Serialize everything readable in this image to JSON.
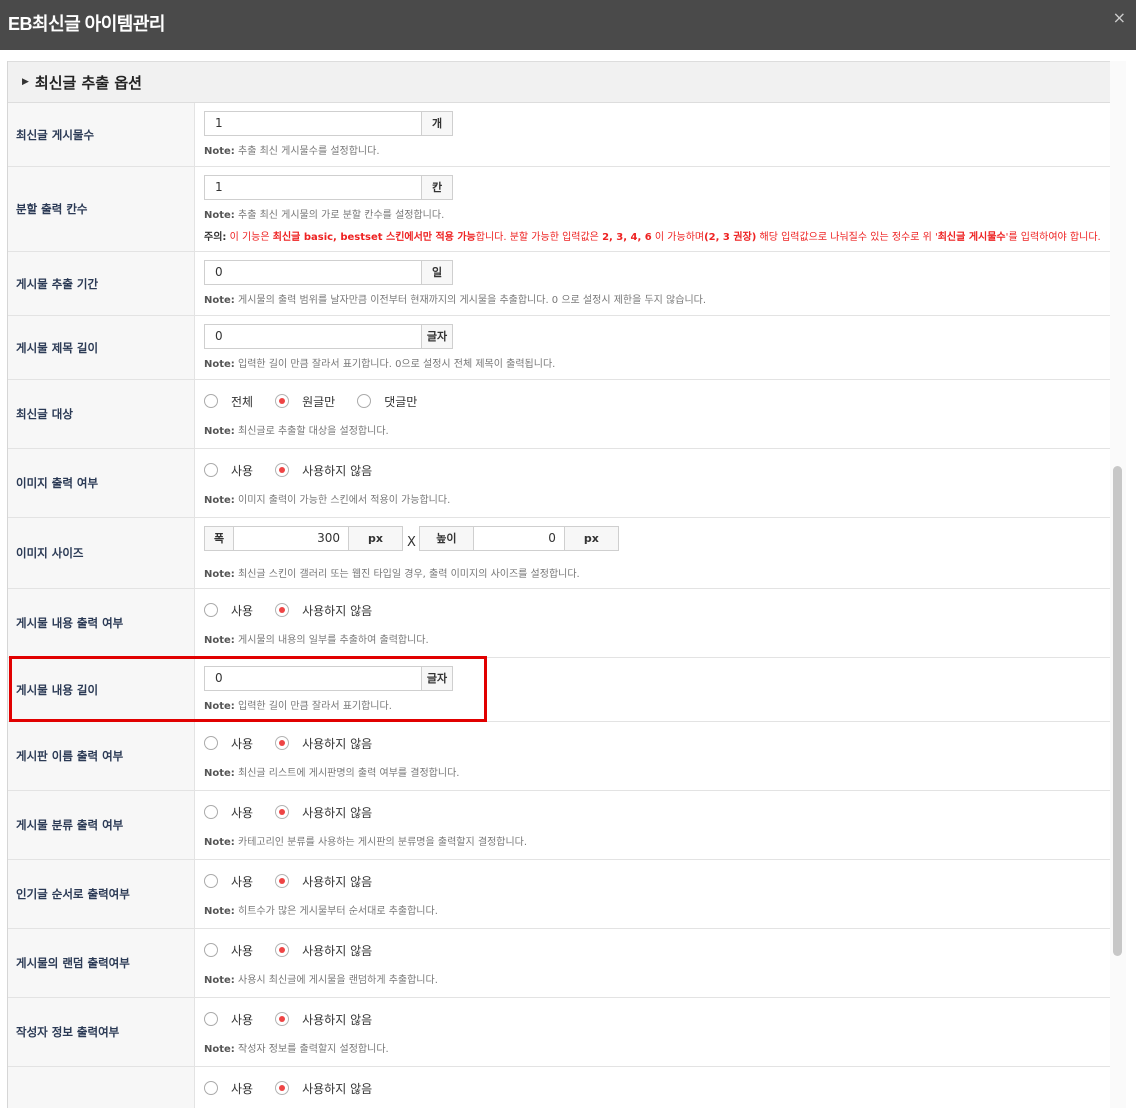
{
  "window": {
    "title": "EB최신글 아이템관리",
    "close_icon": "×"
  },
  "section": {
    "title": "최신글 추출 옵션"
  },
  "rows": {
    "post_count": {
      "label": "최신글 게시물수",
      "value": "1",
      "unit": "개",
      "note_prefix": "Note:",
      "note": " 추출 최신 게시물수를 설정합니다."
    },
    "columns": {
      "label": "분할 출력 칸수",
      "value": "1",
      "unit": "칸",
      "note_prefix": "Note:",
      "note": " 추출 최신 게시물의 가로 분할 칸수를 설정합니다.",
      "warn_head": "주의:",
      "warn_1": " 이 기능은 ",
      "warn_b1": "최신글 basic, bestset 스킨에서만 적용 가능",
      "warn_2": "합니다. 분할 가능한 입력값은 ",
      "warn_b2": "2, 3, 4, 6",
      "warn_3": " 이 가능하며",
      "warn_b3": "(2, 3 권장)",
      "warn_4": " 해당 입력값으로 나눠질수 있는 정수로 위 '",
      "warn_b4": "최신글 게시물수",
      "warn_5": "'를 입력하여야 합니다."
    },
    "period": {
      "label": "게시물 추출 기간",
      "value": "0",
      "unit": "일",
      "note_prefix": "Note:",
      "note": " 게시물의 출력 범위를 날자만큼 이전부터 현재까지의 게시물을 추출합니다. 0 으로 설정시 제한을 두지 않습니다."
    },
    "title_len": {
      "label": "게시물 제목 길이",
      "value": "0",
      "unit": "글자",
      "note_prefix": "Note:",
      "note": " 입력한 길이 만큼 잘라서 표기합니다. 0으로 설정시 전체 제목이 출력됩니다."
    },
    "target": {
      "label": "최신글 대상",
      "opt1": "전체",
      "opt2": "원글만",
      "opt3": "댓글만",
      "note_prefix": "Note:",
      "note": " 최신글로 추출할 대상을 설정합니다."
    },
    "image_out": {
      "label": "이미지 출력 여부",
      "opt1": "사용",
      "opt2": "사용하지 않음",
      "note_prefix": "Note:",
      "note": " 이미지 출력이 가능한 스킨에서 적용이 가능합니다."
    },
    "image_size": {
      "label": "이미지 사이즈",
      "w_label": "폭",
      "w_value": "300",
      "w_unit": "px",
      "x": "X",
      "h_label": "높이",
      "h_value": "0",
      "h_unit": "px",
      "note_prefix": "Note:",
      "note": " 최신글 스킨이 갤러리 또는 웹진 타입일 경우, 출력 이미지의 사이즈를 설정합니다."
    },
    "content_out": {
      "label": "게시물 내용 출력 여부",
      "opt1": "사용",
      "opt2": "사용하지 않음",
      "note_prefix": "Note:",
      "note": " 게시물의 내용의 일부를 추출하여 출력합니다."
    },
    "content_len": {
      "label": "게시물 내용 길이",
      "value": "0",
      "unit": "글자",
      "note_prefix": "Note:",
      "note": " 입력한 길이 만큼 잘라서 표기합니다."
    },
    "board_name": {
      "label": "게시판 이름 출력 여부",
      "opt1": "사용",
      "opt2": "사용하지 않음",
      "note_prefix": "Note:",
      "note": " 최신글 리스트에 게시판명의 출력 여부를 결정합니다."
    },
    "category": {
      "label": "게시물 분류 출력 여부",
      "opt1": "사용",
      "opt2": "사용하지 않음",
      "note_prefix": "Note:",
      "note": " 카테고리인 분류를 사용하는 게시판의 분류명을 출력할지 결정합니다."
    },
    "popular": {
      "label": "인기글 순서로 출력여부",
      "opt1": "사용",
      "opt2": "사용하지 않음",
      "note_prefix": "Note:",
      "note": " 히트수가 많은 게시물부터 순서대로 추출합니다."
    },
    "random": {
      "label": "게시물의 랜덤 출력여부",
      "opt1": "사용",
      "opt2": "사용하지 않음",
      "note_prefix": "Note:",
      "note": " 사용시 최신글에 게시물을 랜덤하게 추출합니다."
    },
    "author": {
      "label": "작성자 정보 출력여부",
      "opt1": "사용",
      "opt2": "사용하지 않음",
      "note_prefix": "Note:",
      "note": " 작성자 정보를 출력할지 설정합니다."
    },
    "last": {
      "opt1": "사용",
      "opt2": "사용하지 않음"
    }
  },
  "colors": {
    "titlebar": "#4a4a4a",
    "accent": "#e44444",
    "highlight": "#e10000"
  }
}
